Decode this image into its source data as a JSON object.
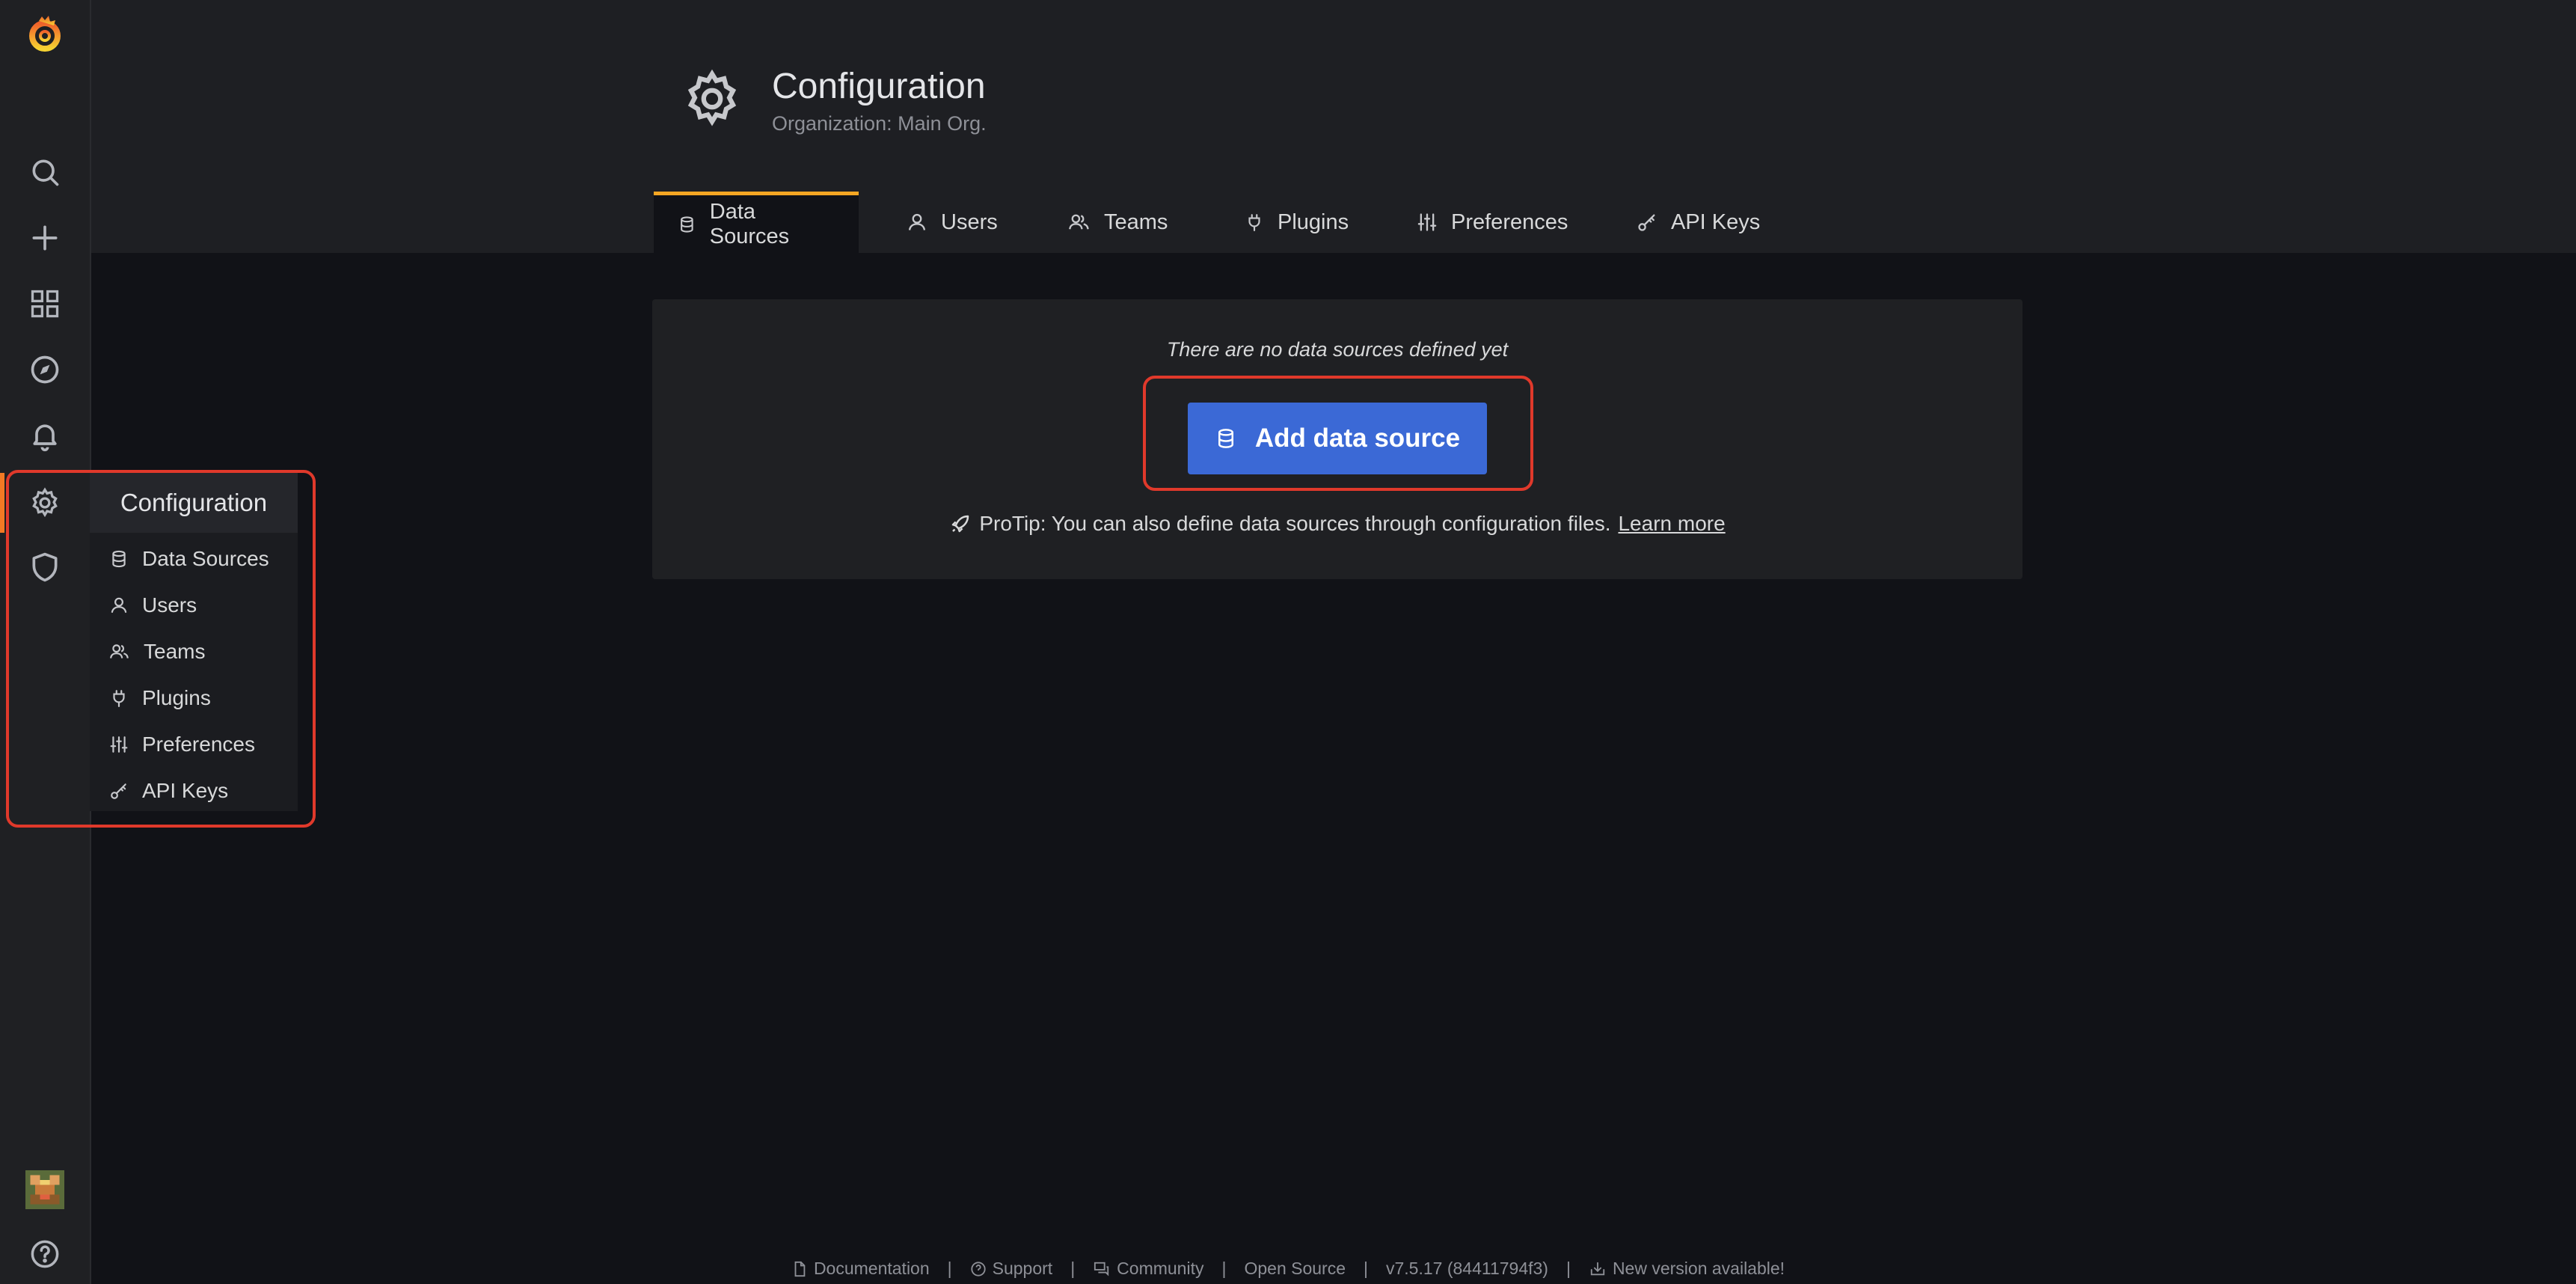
{
  "sidebar": {
    "items": [
      {
        "name": "grafana-logo-icon"
      },
      {
        "name": "search-icon"
      },
      {
        "name": "plus-icon"
      },
      {
        "name": "dashboards-icon"
      },
      {
        "name": "explore-compass-icon"
      },
      {
        "name": "alerting-bell-icon"
      },
      {
        "name": "configuration-gear-icon"
      },
      {
        "name": "server-admin-shield-icon"
      },
      {
        "name": "user-avatar"
      },
      {
        "name": "help-icon"
      }
    ],
    "active_color": "#f27a24"
  },
  "header": {
    "title": "Configuration",
    "subtitle": "Organization: Main Org."
  },
  "tabs": [
    {
      "label": "Data Sources",
      "icon": "database-icon",
      "active": true
    },
    {
      "label": "Users",
      "icon": "user-icon"
    },
    {
      "label": "Teams",
      "icon": "users-icon"
    },
    {
      "label": "Plugins",
      "icon": "plug-icon"
    },
    {
      "label": "Preferences",
      "icon": "sliders-icon"
    },
    {
      "label": "API Keys",
      "icon": "key-icon"
    }
  ],
  "empty_state": {
    "message": "There are no data sources defined yet",
    "button_label": "Add data source",
    "protip": "ProTip: You can also define data sources through configuration files.",
    "learn_more": "Learn more"
  },
  "menu": {
    "title": "Configuration",
    "items": [
      {
        "label": "Data Sources",
        "icon": "database-icon"
      },
      {
        "label": "Users",
        "icon": "user-icon"
      },
      {
        "label": "Teams",
        "icon": "users-icon"
      },
      {
        "label": "Plugins",
        "icon": "plug-icon"
      },
      {
        "label": "Preferences",
        "icon": "sliders-icon"
      },
      {
        "label": "API Keys",
        "icon": "key-icon"
      }
    ]
  },
  "footer": {
    "documentation": "Documentation",
    "support": "Support",
    "community": "Community",
    "open_source": "Open Source",
    "version": "v7.5.17 (84411794f3)",
    "new_version": "New version available!",
    "separator": "|"
  },
  "colors": {
    "background": "#111217",
    "panel": "#1f2023",
    "primary_button": "#3b69d6",
    "tab_active_border": "#f5a623",
    "highlight_outline": "#e0392b"
  }
}
